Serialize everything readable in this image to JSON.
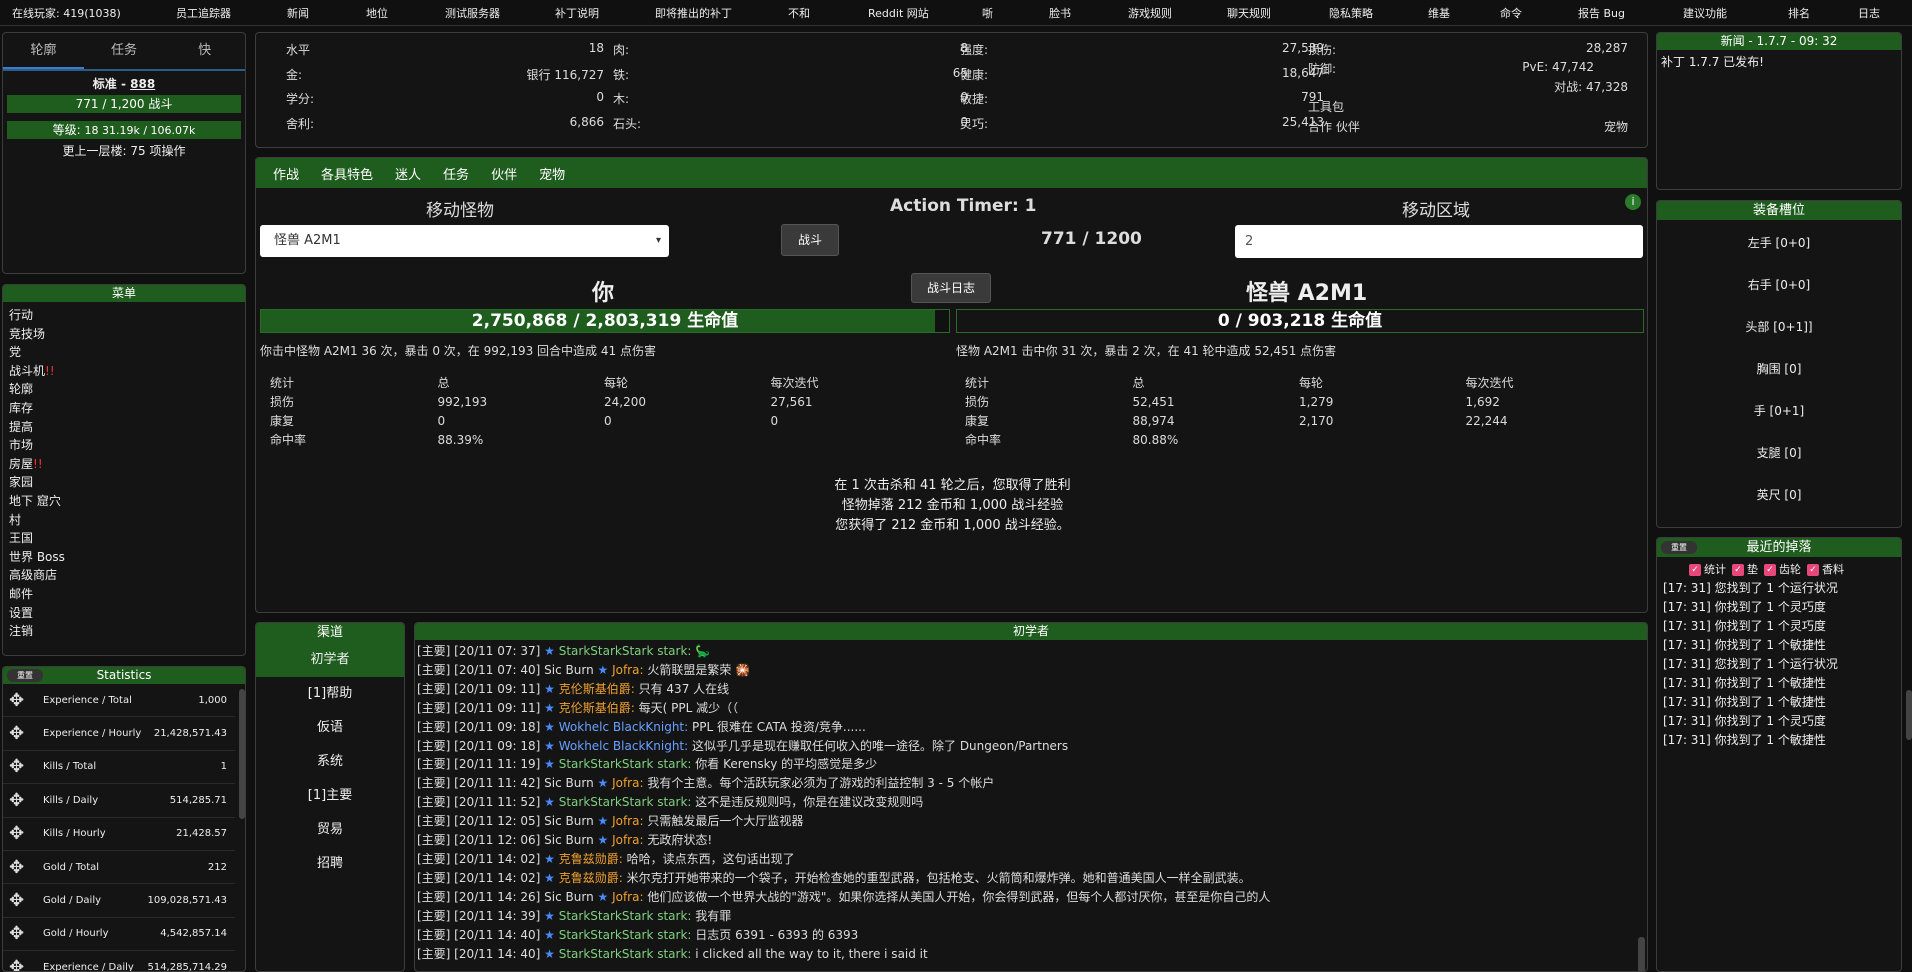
{
  "topnav": [
    "在线玩家: 419(1038)",
    "员工追踪器",
    "新闻",
    "地位",
    "测试服务器",
    "补丁说明",
    "即将推出的补丁",
    "不和",
    "Reddit 网站",
    "哳",
    "脸书",
    "游戏规则",
    "聊天规则",
    "隐私策略",
    "维基",
    "命令",
    "报告 Bug",
    "建议功能",
    "排名",
    "日志"
  ],
  "left": {
    "tabs": [
      "轮廓",
      "任务",
      "快"
    ],
    "standard_label": "标准 - ",
    "standard_val": "888",
    "battle_bar": "771 / 1,200 战斗",
    "level_label": "等级:",
    "level_val": "18 31.19k / 106.07k",
    "last_floor": "更上一层楼: 75 项操作"
  },
  "menu": {
    "title": "菜单",
    "items": [
      "行动",
      "竞技场",
      "党",
      "战斗机",
      "轮廓",
      "库存",
      "提高",
      "市场",
      "房屋",
      "家园",
      "地下 窟穴",
      "村",
      "王国",
      "世界 Boss",
      "高级商店",
      "邮件",
      "设置",
      "注销"
    ],
    "alerts": {
      "3": "!!",
      "8": "!!"
    }
  },
  "stats": {
    "reset": "重置",
    "title": "Statistics",
    "rows": [
      [
        "Experience / Total",
        "1,000"
      ],
      [
        "Experience / Hourly",
        "21,428,571.43"
      ],
      [
        "Kills / Total",
        "1"
      ],
      [
        "Kills / Daily",
        "514,285.71"
      ],
      [
        "Kills / Hourly",
        "21,428.57"
      ],
      [
        "Gold / Total",
        "212"
      ],
      [
        "Gold / Daily",
        "109,028,571.43"
      ],
      [
        "Gold / Hourly",
        "4,542,857.14"
      ],
      [
        "Experience / Daily",
        "514,285,714.29"
      ]
    ]
  },
  "player": {
    "c1": [
      [
        "水平",
        "18"
      ],
      [
        "金:",
        "银行 116,727"
      ],
      [
        "学分:",
        "0"
      ],
      [
        "舍利:",
        "6,866"
      ]
    ],
    "c2": [
      [
        "肉:",
        "8"
      ],
      [
        "铁:",
        "65"
      ],
      [
        "木:",
        "0"
      ],
      [
        "石头:",
        "0"
      ]
    ],
    "c3": [
      [
        "强度:",
        "27,539"
      ],
      [
        "健康:",
        "18,647"
      ],
      [
        "敏捷:",
        "791"
      ],
      [
        "灵巧:",
        "25,413"
      ]
    ],
    "c4": {
      "dmg_label": "损伤:",
      "dmg_val": "28,287",
      "def_label": "防御:",
      "pve": "PvE: 47,742",
      "pvp": "对战: 47,328",
      "toolkit": "工具包",
      "partner_label": "合作 伙伴",
      "partner_val": "宠物"
    }
  },
  "battle": {
    "tabs": [
      "作战",
      "各具特色",
      "迷人",
      "任务",
      "伙伴",
      "宠物"
    ],
    "move_monster": "移动怪物",
    "timer": "Action Timer: 1",
    "move_area": "移动区域",
    "monster_select": "怪兽 A2M1",
    "fight": "战斗",
    "counter": "771 / 1200",
    "area_input": "2",
    "log_btn": "战斗日志",
    "you": "你",
    "enemy": "怪兽 A2M1",
    "you_hp": "2,750,868 / 2,803,319 生命值",
    "enemy_hp": "0 / 903,218 生命值",
    "you_line": "你击中怪物 A2M1 36 次，暴击 0 次，在 992,193 回合中造成 41 点伤害",
    "enemy_line": "怪物 A2M1 击中你 31 次，暴击 2 次，在 41 轮中造成 52,451 点伤害",
    "thead": [
      "统计",
      "总",
      "每轮",
      "每次迭代"
    ],
    "you_rows": [
      [
        "损伤",
        "992,193",
        "24,200",
        "27,561"
      ],
      [
        "康复",
        "0",
        "0",
        "0"
      ],
      [
        "命中率",
        "88.39%",
        "",
        ""
      ]
    ],
    "enemy_rows": [
      [
        "损伤",
        "52,451",
        "1,279",
        "1,692"
      ],
      [
        "康复",
        "88,974",
        "2,170",
        "22,244"
      ],
      [
        "命中率",
        "80.88%",
        "",
        ""
      ]
    ],
    "result": [
      "在 1 次击杀和 41 轮之后，您取得了胜利",
      "怪物掉落 212 金币和 1,000 战斗经验",
      "您获得了 212 金币和 1,000 战斗经验。"
    ]
  },
  "channels": {
    "title": "渠道",
    "items": [
      "初学者",
      "[1]帮助",
      "仮语",
      "系统",
      "[1]主要",
      "贸易",
      "招聘"
    ]
  },
  "chat": {
    "title": "初学者",
    "lines": [
      {
        "p": "[主要] [20/11 07: 37]",
        "n": "StarkStarkStark stark:",
        "c": "name-green",
        "m": "🦕"
      },
      {
        "p": "[主要] [20/11 07: 40] Sic Burn",
        "n": "Jofra:",
        "c": "name",
        "m": "火箭联盟是繁荣 🎇"
      },
      {
        "p": "[主要] [20/11 09: 11]",
        "n": "克伦斯基伯爵:",
        "c": "name",
        "m": "只有 437 人在线"
      },
      {
        "p": "[主要] [20/11 09: 11]",
        "n": "克伦斯基伯爵:",
        "c": "name",
        "m": "每天( PPL 减少（（"
      },
      {
        "p": "[主要] [20/11 09: 18]",
        "n": "Wokhelc BlackKnight:",
        "c": "name-blue",
        "m": "PPL 很难在 CATA 投资/竞争......"
      },
      {
        "p": "[主要] [20/11 09: 18]",
        "n": "Wokhelc BlackKnight:",
        "c": "name-blue",
        "m": "这似乎几乎是现在赚取任何收入的唯一途径。除了 Dungeon/Partners"
      },
      {
        "p": "[主要] [20/11 11: 19]",
        "n": "StarkStarkStark stark:",
        "c": "name-green",
        "m": "你看 Kerensky 的平均感觉是多少"
      },
      {
        "p": "[主要] [20/11 11: 42] Sic Burn",
        "n": "Jofra:",
        "c": "name",
        "m": "我有个主意。每个活跃玩家必须为了游戏的利益控制 3 - 5 个帐户"
      },
      {
        "p": "[主要] [20/11 11: 52]",
        "n": "StarkStarkStark stark:",
        "c": "name-green",
        "m": "这不是违反规则吗，你是在建议改变规则吗"
      },
      {
        "p": "[主要] [20/11 12: 05] Sic Burn",
        "n": "Jofra:",
        "c": "name",
        "m": "只需触发最后一个大厅监视器"
      },
      {
        "p": "[主要] [20/11 12: 06] Sic Burn",
        "n": "Jofra:",
        "c": "name",
        "m": "无政府状态!"
      },
      {
        "p": "[主要] [20/11 14: 02]",
        "n": "克鲁兹勋爵:",
        "c": "name",
        "m": "哈哈，读点东西，这句话出现了"
      },
      {
        "p": "[主要] [20/11 14: 02]",
        "n": "克鲁兹勋爵:",
        "c": "name",
        "m": "米尔克打开她带来的一个袋子，开始检查她的重型武器，包括枪支、火箭筒和爆炸弹。她和普通美国人一样全副武装。"
      },
      {
        "p": "[主要] [20/11 14: 26] Sic Burn",
        "n": "Jofra:",
        "c": "name",
        "m": "他们应该做一个世界大战的\"游戏\"。如果你选择从美国人开始，你会得到武器，但每个人都讨厌你，甚至是你自己的人"
      },
      {
        "p": "[主要] [20/11 14: 39]",
        "n": "StarkStarkStark stark:",
        "c": "name-green",
        "m": "我有罪"
      },
      {
        "p": "[主要] [20/11 14: 40]",
        "n": "StarkStarkStark stark:",
        "c": "name-green",
        "m": "日志页 6391 - 6393 的 6393"
      },
      {
        "p": "[主要] [20/11 14: 40]",
        "n": "StarkStarkStark stark:",
        "c": "name-green",
        "m": "i clicked all the way to it, there i said it"
      }
    ]
  },
  "news": {
    "title": "新闻 - 1.7.7 - 09: 32",
    "body": "补丁 1.7.7 已发布!"
  },
  "equip": {
    "title": "装备槽位",
    "items": [
      "左手 [0+0]",
      "右手 [0+0]",
      "头部 [0+1]]",
      "胸围 [0]",
      "手 [0+1]",
      "支腿 [0]",
      "英尺 [0]"
    ]
  },
  "drops": {
    "reset": "重置",
    "title": "最近的掉落",
    "filters": [
      "统计",
      "垫",
      "齿轮",
      "香料"
    ],
    "lines": [
      "[17: 31] 您找到了 1 个运行状况",
      "[17: 31] 你找到了 1 个灵巧度",
      "[17: 31] 你找到了 1 个灵巧度",
      "[17: 31] 你找到了 1 个敏捷性",
      "[17: 31] 您找到了 1 个运行状况",
      "[17: 31] 你找到了 1 个敏捷性",
      "[17: 31] 你找到了 1 个敏捷性",
      "[17: 31] 你找到了 1 个灵巧度",
      "[17: 31] 你找到了 1 个敏捷性"
    ]
  }
}
